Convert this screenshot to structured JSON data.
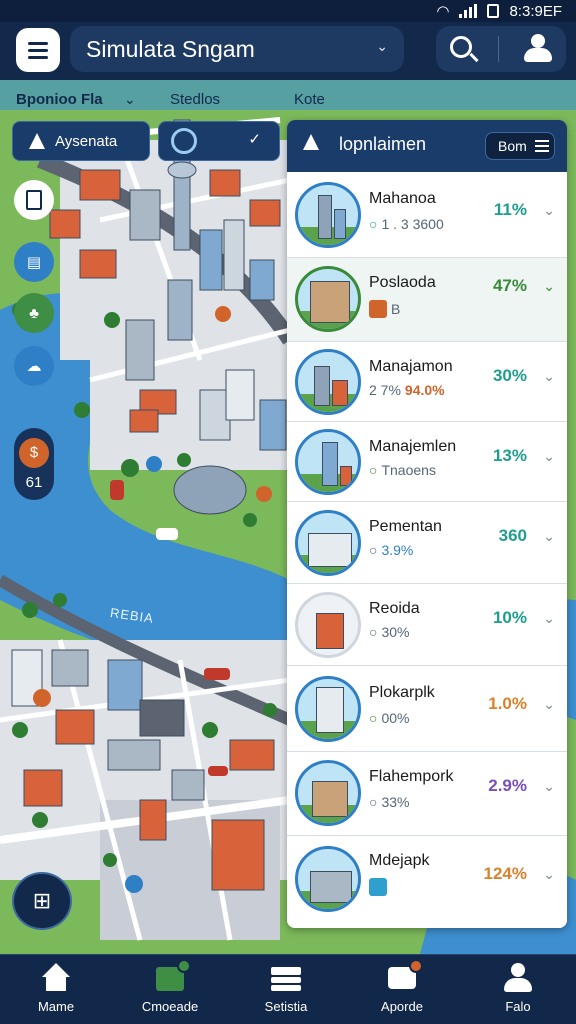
{
  "status_bar": {
    "time": "8:3:9EF"
  },
  "header": {
    "title": "Simulata Sngam"
  },
  "filters": {
    "first": "Bponioo Fla",
    "second": "Stedlos",
    "third": "Kote"
  },
  "chips": {
    "primary": "Aysenata"
  },
  "map": {
    "lake_label": "REBIA",
    "stat_value": "61"
  },
  "panel": {
    "title": "lopnlaimen",
    "sort_label": "Bom",
    "items": [
      {
        "name": "Mahanoa",
        "sub": "1 . 3 3600",
        "pct": "11%",
        "pct_color": "#1f9e8e"
      },
      {
        "name": "Poslaoda",
        "sub": "B",
        "pct": "47%",
        "pct_color": "#3a8a3a"
      },
      {
        "name": "Manajamon",
        "sub": "2 7%",
        "sub_highlight": "94.0%",
        "pct": "30%",
        "pct_color": "#1f9e8e"
      },
      {
        "name": "Manajemlen",
        "sub": "Tnaoens",
        "pct": "13%",
        "pct_color": "#1f9e8e"
      },
      {
        "name": "Pementan",
        "sub": "3.9%",
        "pct": "360",
        "pct_color": "#1f9e8e"
      },
      {
        "name": "Reoida",
        "sub": "30%",
        "pct": "10%",
        "pct_color": "#1f9e8e"
      },
      {
        "name": "Plokarplk",
        "sub": "00%",
        "pct": "1.0%",
        "pct_color": "#d9822b"
      },
      {
        "name": "Flahempork",
        "sub": "33%",
        "pct": "2.9%",
        "pct_color": "#7b4fb8"
      },
      {
        "name": "Mdejapk",
        "sub": "",
        "pct": "124%",
        "pct_color": "#d9822b"
      }
    ]
  },
  "bottom_nav": [
    {
      "label": "Mame"
    },
    {
      "label": "Cmoeade"
    },
    {
      "label": "Setistia"
    },
    {
      "label": "Aporde"
    },
    {
      "label": "Falo"
    }
  ],
  "colors": {
    "navy": "#13294c",
    "accent_blue": "#2f7fc7",
    "teal": "#1f9e8e",
    "orange": "#d9822b",
    "green": "#3a8a3a"
  }
}
